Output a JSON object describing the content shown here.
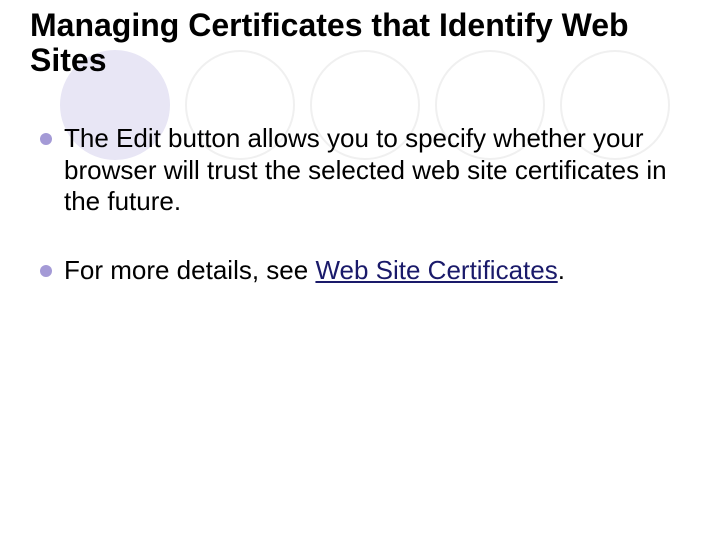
{
  "title": "Managing Certificates that Identify Web Sites",
  "bullets": [
    {
      "text": "The Edit button allows you to specify whether your browser will trust the selected web site certificates in the future."
    },
    {
      "prefix": "For more details, see ",
      "link": "Web Site Certificates",
      "suffix": "."
    }
  ]
}
